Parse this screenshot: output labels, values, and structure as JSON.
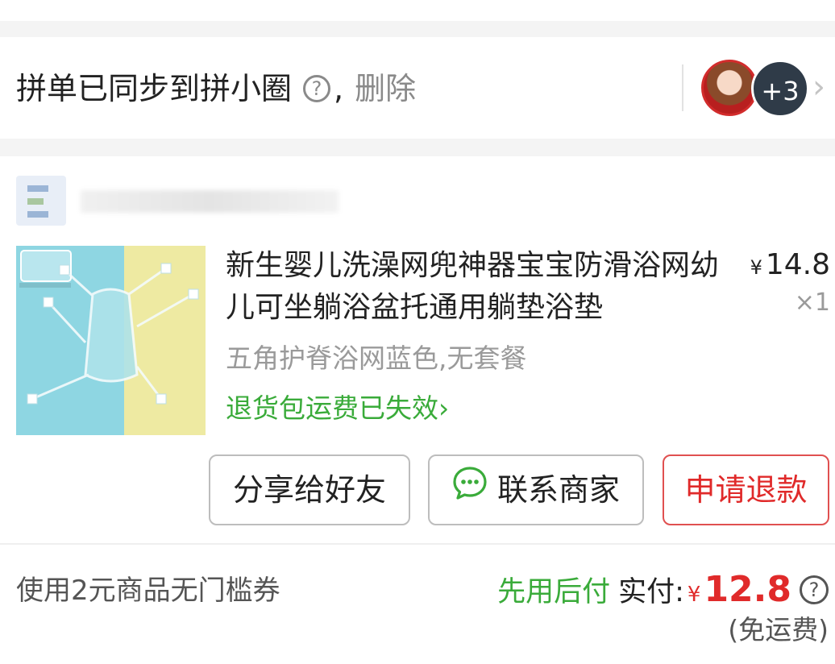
{
  "sync_bar": {
    "text": "拼单已同步到拼小圈",
    "help_glyph": "?",
    "comma": ",",
    "delete_label": "删除",
    "more_members": "+3",
    "chevron": "›"
  },
  "store": {
    "name": ""
  },
  "product": {
    "title": "新生婴儿洗澡网兜神器宝宝防滑浴网幼儿可坐躺浴盆托通用躺垫浴垫",
    "currency": "¥",
    "price": "14.8",
    "quantity": "×1",
    "spec": "五角护脊浴网蓝色,无套餐",
    "return_shipping_status": "退货包运费已失效",
    "return_shipping_chevron": "›"
  },
  "actions": {
    "share_label": "分享给好友",
    "contact_label": "联系商家",
    "refund_label": "申请退款"
  },
  "footer": {
    "coupon_text": "使用2元商品无门槛券",
    "pay_later_label": "先用后付",
    "paid_label": "实付:",
    "currency": "¥",
    "paid_amount": "12.8",
    "help_glyph": "?",
    "shipping_note": "(免运费)"
  },
  "colors": {
    "accent_green": "#3aab3a",
    "accent_red": "#e02a2a",
    "muted_gray": "#9a9a9a"
  },
  "icons": {
    "help": "help-circle-icon",
    "chat": "chat-bubble-icon",
    "chevron": "chevron-right-icon"
  }
}
